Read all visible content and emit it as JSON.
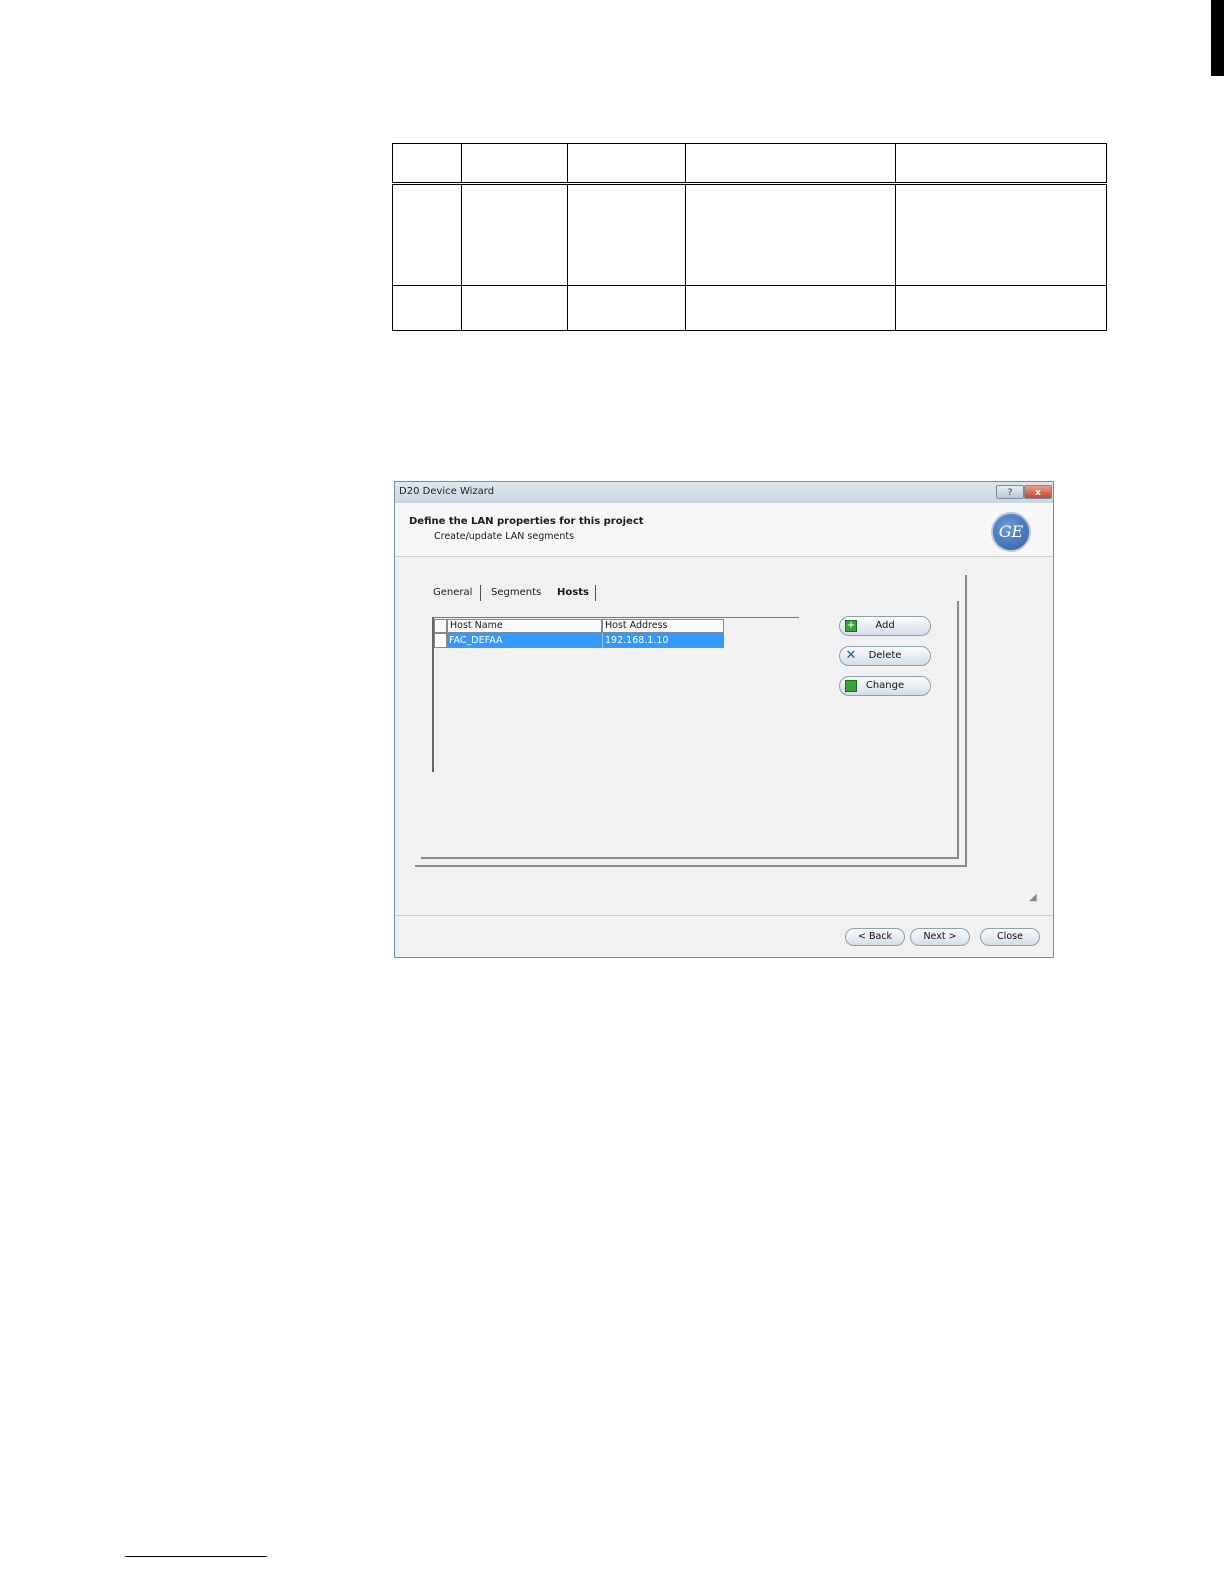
{
  "dialog": {
    "window_title": "D20 Device Wizard",
    "help_button": "?",
    "close_button": "x",
    "header_title": "Define the LAN properties for this project",
    "header_subtitle": "Create/update LAN segments",
    "logo_text": "GE",
    "tabs": [
      {
        "label": "General"
      },
      {
        "label": "Segments"
      },
      {
        "label": "Hosts",
        "active": true
      }
    ],
    "hosts_grid": {
      "columns": [
        "Host Name",
        "Host Address"
      ],
      "rows": [
        {
          "host_name": "FAC_DEFAA",
          "host_address": "192.168.1.10",
          "selected": true
        }
      ]
    },
    "side_buttons": {
      "add": "Add",
      "delete": "Delete",
      "change": "Change"
    },
    "footer_buttons": {
      "back": "< Back",
      "next": "Next >",
      "close": "Close"
    }
  },
  "colors": {
    "selection": "#3399ff",
    "title_bar": "#c9d6e3",
    "close_button": "#c8442b"
  }
}
